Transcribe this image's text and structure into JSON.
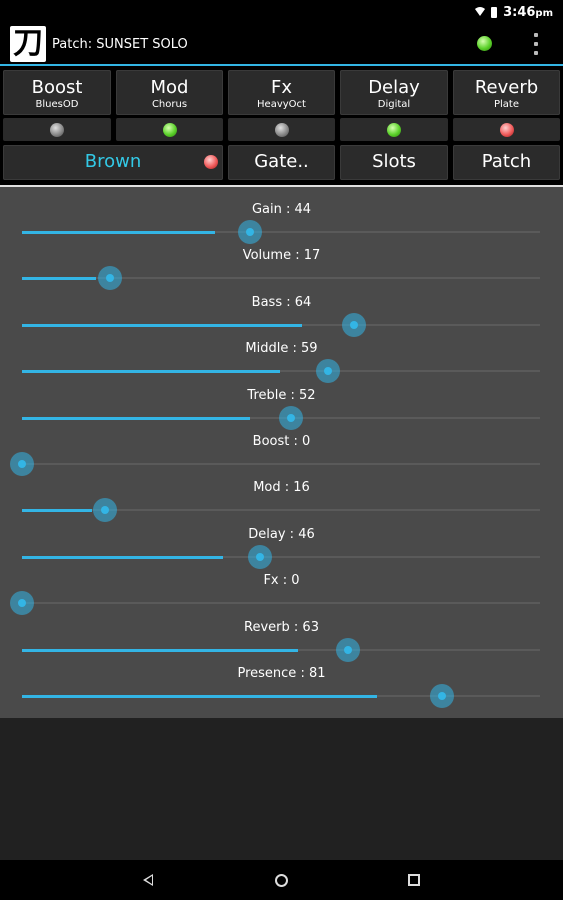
{
  "status_bar": {
    "time": "3:46",
    "ampm": "pm"
  },
  "app_bar": {
    "logo_glyph": "刀",
    "patch_prefix": "Patch:",
    "patch_name": "SUNSET SOLO",
    "connection_led_color": "#5bd12a"
  },
  "effect_tiles": [
    {
      "name": "Boost",
      "type": "BluesOD",
      "led": "grey"
    },
    {
      "name": "Mod",
      "type": "Chorus",
      "led": "green"
    },
    {
      "name": "Fx",
      "type": "HeavyOct",
      "led": "grey"
    },
    {
      "name": "Delay",
      "type": "Digital",
      "led": "green"
    },
    {
      "name": "Reverb",
      "type": "Plate",
      "led": "red"
    }
  ],
  "buttons": {
    "amp_label": "Brown",
    "amp_led": "red",
    "gate_label": "Gate..",
    "slots_label": "Slots",
    "patch_label": "Patch"
  },
  "sliders": [
    {
      "name": "Gain",
      "value": 44
    },
    {
      "name": "Volume",
      "value": 17
    },
    {
      "name": "Bass",
      "value": 64
    },
    {
      "name": "Middle",
      "value": 59
    },
    {
      "name": "Treble",
      "value": 52
    },
    {
      "name": "Boost",
      "value": 0
    },
    {
      "name": "Mod",
      "value": 16
    },
    {
      "name": "Delay",
      "value": 46
    },
    {
      "name": "Fx",
      "value": 0
    },
    {
      "name": "Reverb",
      "value": 63
    },
    {
      "name": "Presence",
      "value": 81
    }
  ],
  "colors": {
    "accent": "#33b5e5",
    "amp_label": "#33c9e6",
    "panel": "#4a4a4a"
  },
  "slider_max": 100
}
